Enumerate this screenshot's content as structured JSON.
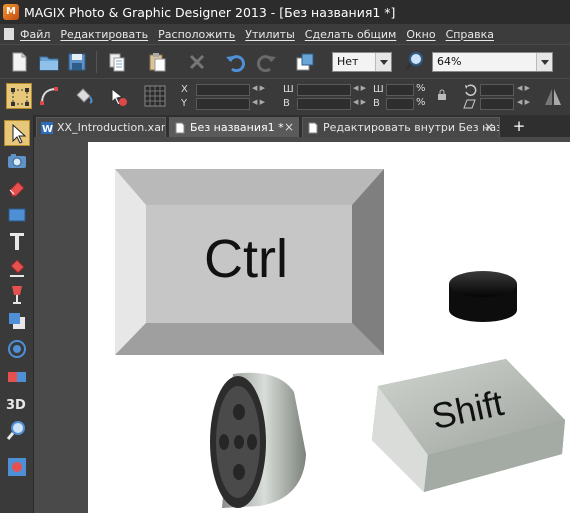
{
  "window": {
    "title": "MAGIX Photo & Graphic Designer 2013 - [Без названия1 *]"
  },
  "menu": [
    "Файл",
    "Редактировать",
    "Расположить",
    "Утилиты",
    "Сделать общим",
    "Окно",
    "Справка"
  ],
  "toolbar": {
    "select_value": "Нет",
    "zoom_value": "64%"
  },
  "toolbar2": {
    "x_label": "X",
    "y_label": "Y",
    "w_label": "Ш",
    "h_label": "В",
    "w2_label": "Ш",
    "h2_label": "В",
    "pct1": "%",
    "pct2": "%"
  },
  "tabs": [
    {
      "label": "XX_Introduction.xar",
      "icon": "w-doc-icon",
      "active": false
    },
    {
      "label": "Без названия1 *",
      "icon": "page-icon",
      "active": true
    },
    {
      "label": "Редактировать внутри Без назв...",
      "icon": "page-icon",
      "active": false
    }
  ],
  "tab_close": "×",
  "tab_add": "+",
  "canvas": {
    "ctrl_key_label": "Ctrl",
    "shift_key_label": "Shift"
  },
  "colors": {
    "app_background": "#3b3b3b",
    "canvas": "#ffffff",
    "selection_tool": "#e7c77a"
  }
}
